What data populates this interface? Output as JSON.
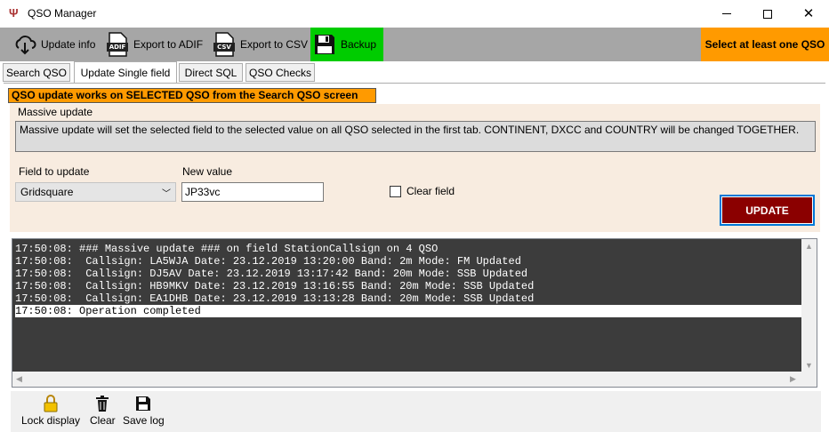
{
  "window": {
    "title": "QSO Manager"
  },
  "toolbar": {
    "update_info": "Update info",
    "export_adif": "Export to ADIF",
    "export_csv": "Export to CSV",
    "backup": "Backup",
    "status": "Select at least one QSO",
    "adif_badge": "ADIF",
    "csv_badge": "CSV",
    "backup_color": "#00cc00",
    "status_color": "#ff9a00"
  },
  "tabs": [
    {
      "label": "Search QSO",
      "active": false
    },
    {
      "label": "Update Single field",
      "active": true
    },
    {
      "label": "Direct SQL",
      "active": false
    },
    {
      "label": "QSO Checks",
      "active": false
    }
  ],
  "banner": "QSO update works on SELECTED QSO from the Search QSO screen",
  "group": {
    "title": "Massive update",
    "description": "Massive update will set the selected field to the selected value on all QSO selected in the first tab. CONTINENT, DXCC and COUNTRY will be changed TOGETHER."
  },
  "form": {
    "field_label": "Field to update",
    "field_value": "Gridsquare",
    "value_label": "New value",
    "value": "JP33vc",
    "clear_label": "Clear field",
    "clear_checked": false,
    "update_button": "UPDATE",
    "update_color": "#8b0000"
  },
  "log": [
    {
      "text": "17:50:08: ### Massive update ### on field StationCallsign on 4 QSO",
      "selected": false
    },
    {
      "text": "17:50:08:  Callsign: LA5WJA Date: 23.12.2019 13:20:00 Band: 2m Mode: FM Updated",
      "selected": false
    },
    {
      "text": "17:50:08:  Callsign: DJ5AV Date: 23.12.2019 13:17:42 Band: 20m Mode: SSB Updated",
      "selected": false
    },
    {
      "text": "17:50:08:  Callsign: HB9MKV Date: 23.12.2019 13:16:55 Band: 20m Mode: SSB Updated",
      "selected": false
    },
    {
      "text": "17:50:08:  Callsign: EA1DHB Date: 23.12.2019 13:13:28 Band: 20m Mode: SSB Updated",
      "selected": false
    },
    {
      "text": "17:50:08: Operation completed",
      "selected": true
    }
  ],
  "bottom": {
    "lock": "Lock display",
    "clear": "Clear",
    "save": "Save log"
  }
}
